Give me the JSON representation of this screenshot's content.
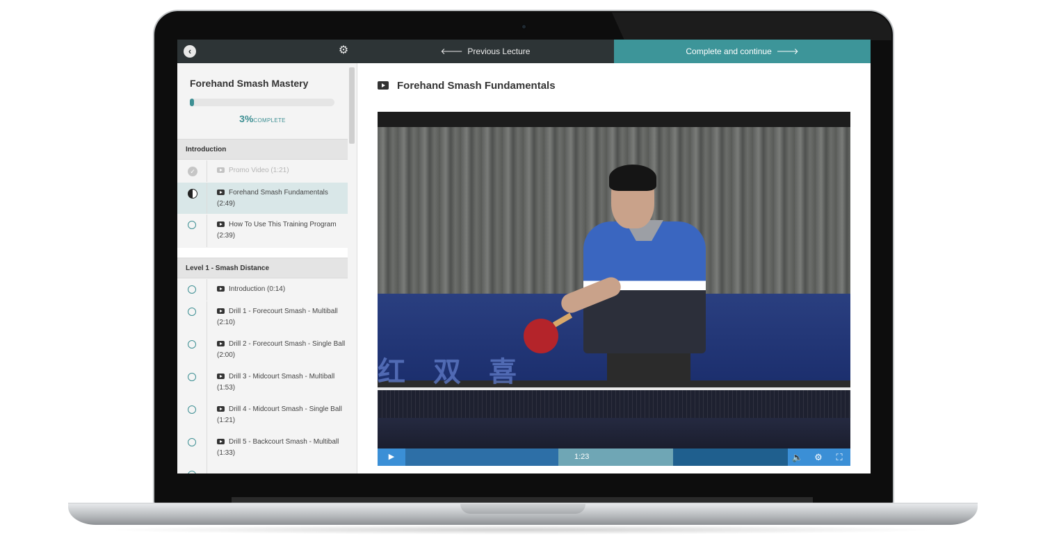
{
  "sidebar": {
    "back_icon": "chevron-left-icon",
    "settings_icon": "gear-icon",
    "course_title": "Forehand Smash Mastery",
    "progress": {
      "percent": 3,
      "percent_label": "3%",
      "complete_label": "COMPLETE"
    },
    "sections": [
      {
        "title": "Introduction",
        "lectures": [
          {
            "title": "Promo Video (1:21)",
            "status": "completed"
          },
          {
            "title": "Forehand Smash Fundamentals (2:49)",
            "status": "in-progress"
          },
          {
            "title": "How To Use This Training Program (2:39)",
            "status": "not-started"
          }
        ]
      },
      {
        "title": "Level 1 - Smash Distance",
        "lectures": [
          {
            "title": "Introduction (0:14)",
            "status": "not-started"
          },
          {
            "title": "Drill 1 - Forecourt Smash - Multiball (2:10)",
            "status": "not-started"
          },
          {
            "title": "Drill 2 - Forecourt Smash - Single Ball (2:00)",
            "status": "not-started"
          },
          {
            "title": "Drill 3 - Midcourt Smash - Multiball (1:53)",
            "status": "not-started"
          },
          {
            "title": "Drill 4 - Midcourt Smash - Single Ball (1:21)",
            "status": "not-started"
          },
          {
            "title": "Drill 5 - Backcourt Smash - Multiball (1:33)",
            "status": "not-started"
          }
        ]
      }
    ]
  },
  "nav": {
    "previous_label": "Previous Lecture",
    "complete_label": "Complete and continue"
  },
  "lecture": {
    "title": "Forehand Smash Fundamentals",
    "video": {
      "current_time": "1:23",
      "played_fraction": 0.4,
      "buffered_fraction": 0.7,
      "watermark_text": "红双喜"
    }
  },
  "colors": {
    "accent": "#3d9599",
    "dark_bar": "#2d3436",
    "player_blue": "#3b8fd6"
  }
}
